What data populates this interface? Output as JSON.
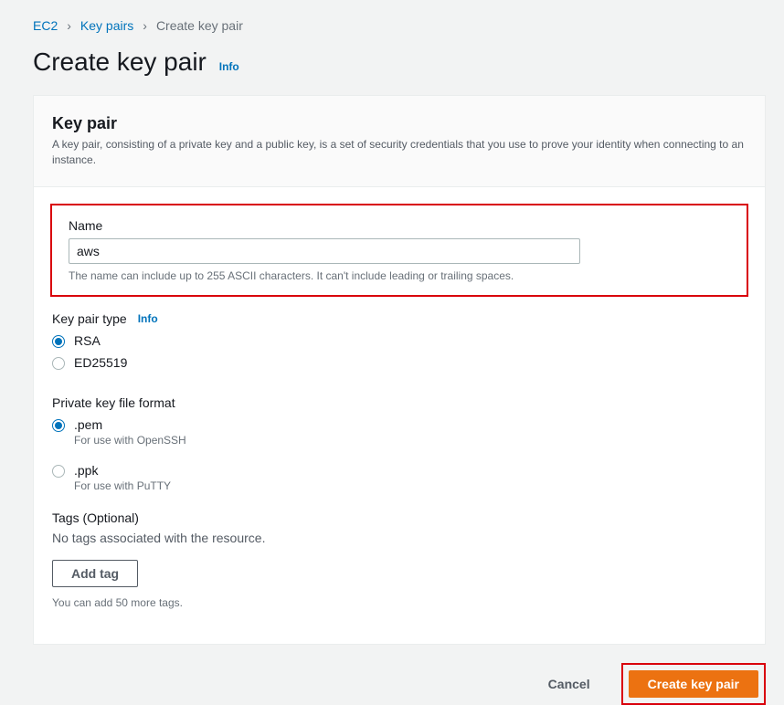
{
  "breadcrumb": {
    "root": "EC2",
    "parent": "Key pairs",
    "current": "Create key pair"
  },
  "page": {
    "title": "Create key pair",
    "info": "Info"
  },
  "panel": {
    "title": "Key pair",
    "description": "A key pair, consisting of a private key and a public key, is a set of security credentials that you use to prove your identity when connecting to an instance."
  },
  "name": {
    "label": "Name",
    "value": "aws",
    "hint": "The name can include up to 255 ASCII characters. It can't include leading or trailing spaces."
  },
  "type": {
    "label": "Key pair type",
    "info": "Info",
    "options": [
      {
        "label": "RSA",
        "selected": true
      },
      {
        "label": "ED25519",
        "selected": false
      }
    ]
  },
  "format": {
    "label": "Private key file format",
    "options": [
      {
        "label": ".pem",
        "desc": "For use with OpenSSH",
        "selected": true
      },
      {
        "label": ".ppk",
        "desc": "For use with PuTTY",
        "selected": false
      }
    ]
  },
  "tags": {
    "label": "Tags (Optional)",
    "empty": "No tags associated with the resource.",
    "add_button": "Add tag",
    "hint": "You can add 50 more tags."
  },
  "actions": {
    "cancel": "Cancel",
    "create": "Create key pair"
  }
}
